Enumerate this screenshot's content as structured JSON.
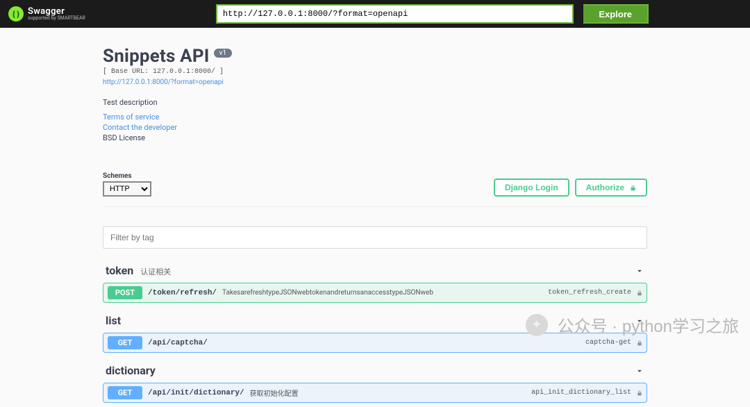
{
  "topbar": {
    "brand_name": "Swagger",
    "brand_sub": "supported by SMARTBEAR",
    "url_value": "http://127.0.0.1:8000/?format=openapi",
    "explore_label": "Explore"
  },
  "info": {
    "title": "Snippets API",
    "version": "v1",
    "base_url_line": "[ Base URL: 127.0.0.1:8000/ ]",
    "spec_link": "http://127.0.0.1:8000/?format=openapi",
    "description": "Test description",
    "terms_label": "Terms of service",
    "contact_label": "Contact the developer",
    "license_label": "BSD License"
  },
  "schemes": {
    "label": "Schemes",
    "selected": "HTTP"
  },
  "auth": {
    "django_login_label": "Django Login",
    "authorize_label": "Authorize"
  },
  "filter": {
    "placeholder": "Filter by tag"
  },
  "tags": [
    {
      "name": "token",
      "desc": "认证相关",
      "ops": [
        {
          "method": "POST",
          "path": "/token/refresh/",
          "summary": "TakesarefreshtypeJSONwebtokenandreturnsanaccesstypeJSONweb",
          "op_id": "token_refresh_create"
        }
      ]
    },
    {
      "name": "list",
      "desc": "",
      "ops": [
        {
          "method": "GET",
          "path": "/api/captcha/",
          "summary": "",
          "op_id": "captcha-get"
        }
      ]
    },
    {
      "name": "dictionary",
      "desc": "",
      "ops": [
        {
          "method": "GET",
          "path": "/api/init/dictionary/",
          "summary": "获取初始化配置",
          "op_id": "api_init_dictionary_list"
        }
      ]
    }
  ],
  "watermark": "公众号 · python学习之旅"
}
